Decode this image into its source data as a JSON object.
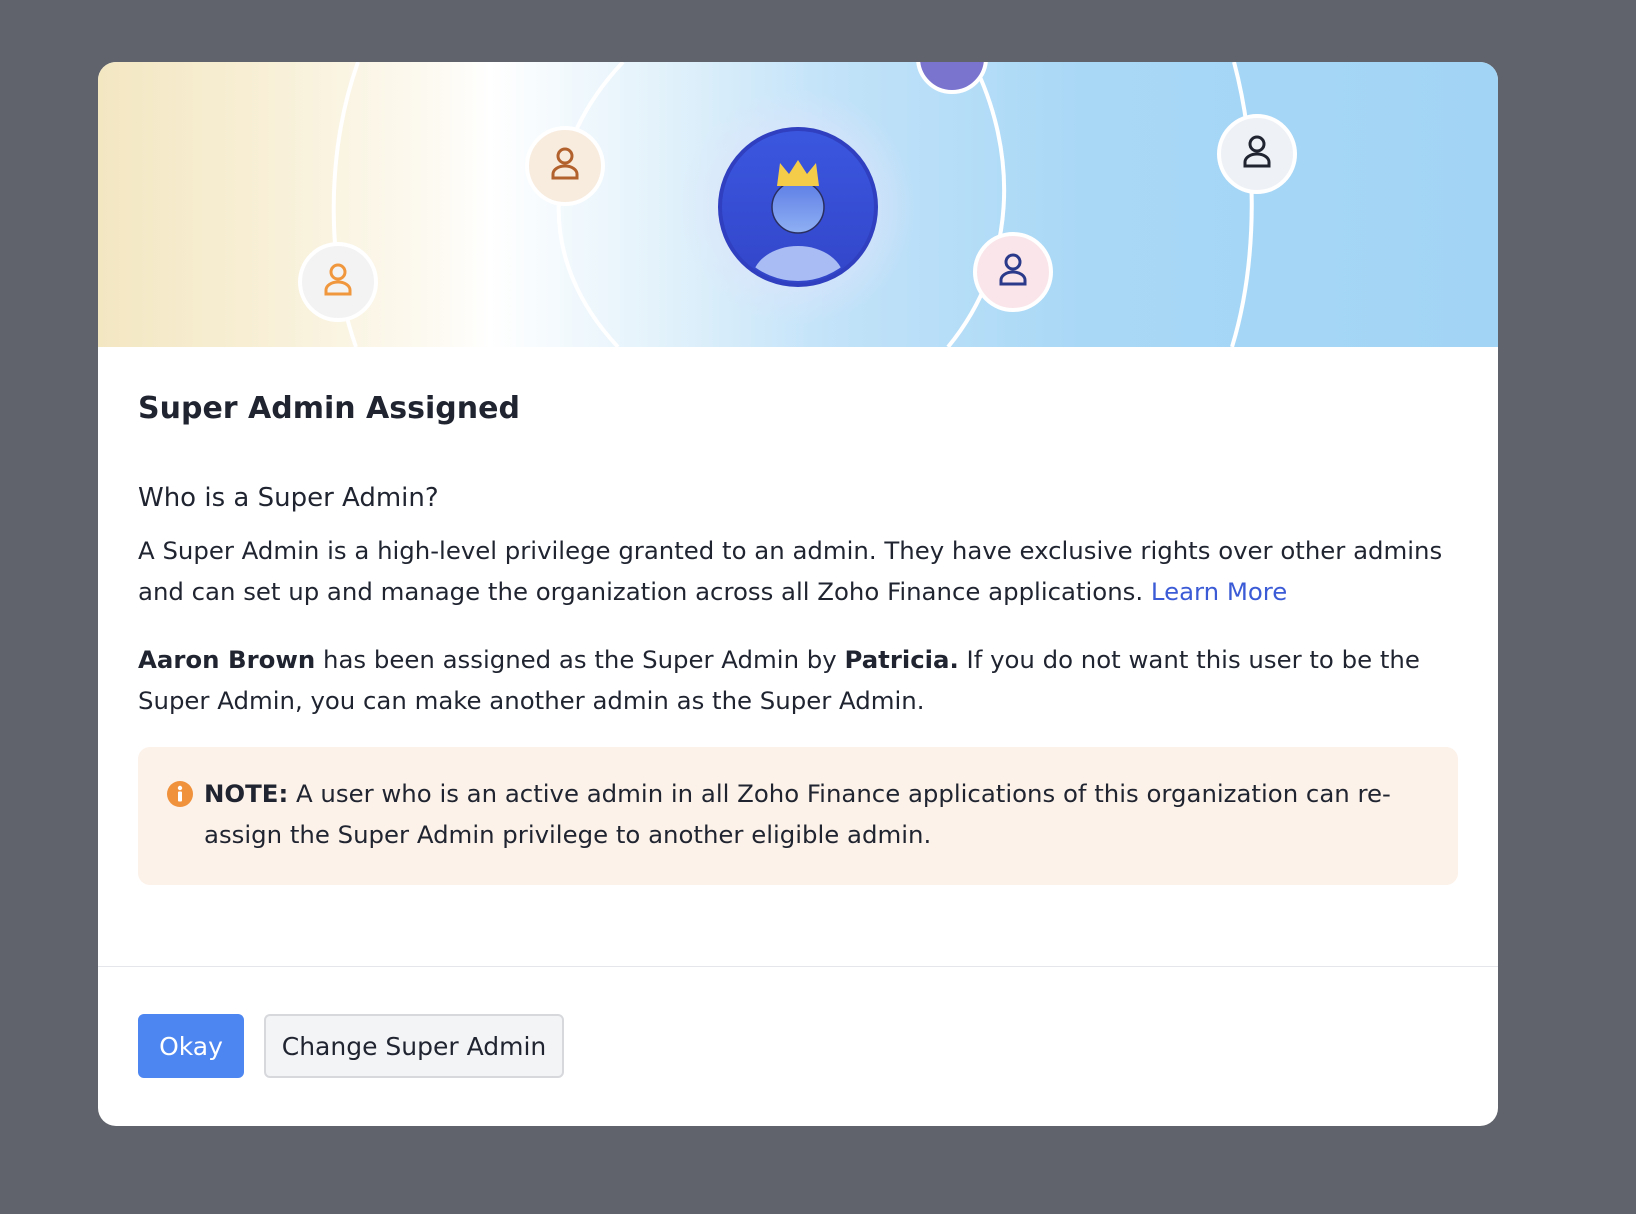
{
  "dialog": {
    "title": "Super Admin Assigned",
    "subheading": "Who is a Super Admin?",
    "description": "A Super Admin is a high-level privilege granted to an admin. They have exclusive rights over other admins and can set up and manage the organization across all Zoho Finance applications.",
    "learn_more": "Learn More",
    "assigned": {
      "user": "Aaron Brown",
      "middle": "has been assigned as the Super Admin by",
      "assigner": "Patricia.",
      "rest": "If you do not want this user to be the Super Admin, you can make another admin as the Super Admin."
    },
    "note": {
      "label": "NOTE:",
      "text": "A user who is an active admin in all Zoho Finance applications of this organization can re-assign the Super Admin privilege to another eligible admin."
    }
  },
  "buttons": {
    "okay": "Okay",
    "change": "Change Super Admin"
  },
  "banner": {
    "icons": [
      "crown-icon",
      "super-admin-avatar-icon",
      "user-icon"
    ]
  },
  "colors": {
    "backdrop": "#60636b",
    "primary_button": "#4d86f0",
    "link": "#3b5bd6",
    "note_background": "#fcf2e9",
    "note_icon": "#f0913c",
    "avatar": "#3d4fd8"
  }
}
